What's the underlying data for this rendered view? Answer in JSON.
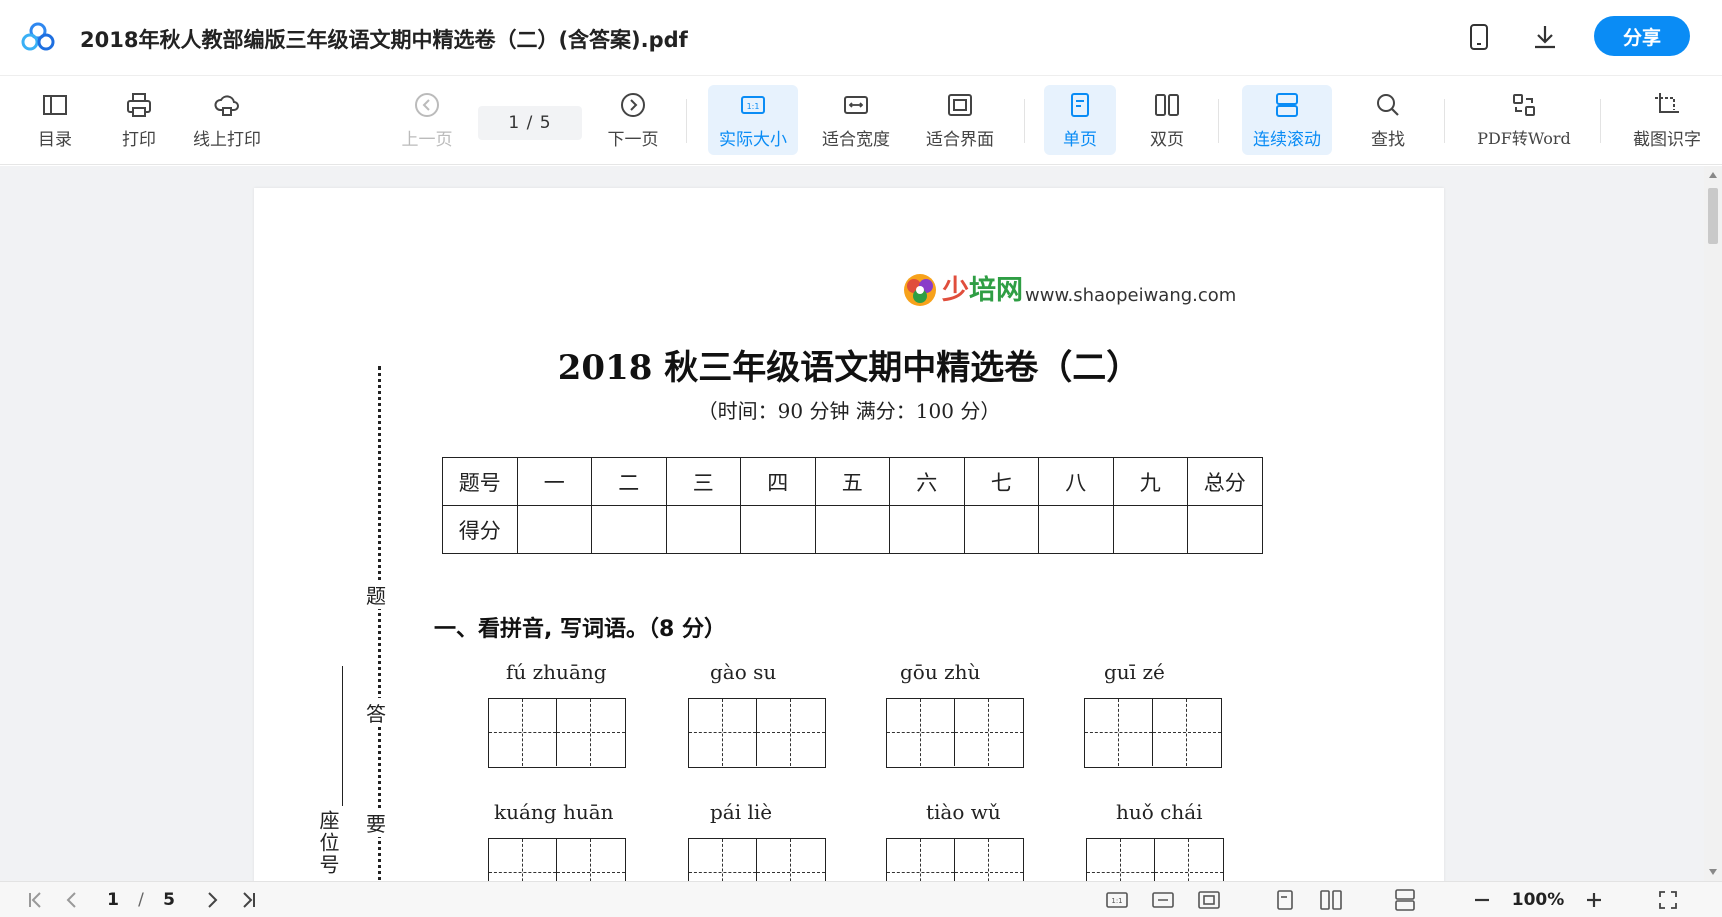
{
  "window": {
    "title": "2018年秋人教部编版三年级语文期中精选卷（二）(含答案).pdf",
    "share_label": "分享"
  },
  "toolbar": {
    "toc": "目录",
    "print": "打印",
    "online_print": "线上打印",
    "prev_page": "上一页",
    "page_indicator": "1 / 5",
    "next_page": "下一页",
    "actual_size": "实际大小",
    "fit_width": "适合宽度",
    "fit_screen": "适合界面",
    "single_page": "单页",
    "double_page": "双页",
    "continuous_scroll": "连续滚动",
    "find": "查找",
    "pdf_to_word": "PDF转Word",
    "ocr": "截图识字",
    "accent_color": "#0a8cf5"
  },
  "document": {
    "brand_cn_1": "少",
    "brand_cn_2": "培网",
    "brand_url": "www.shaopeiwang.com",
    "title": "2018 秋三年级语文期中精选卷（二）",
    "subtitle": "（时间：90 分钟    满分：100 分）",
    "score_table": {
      "row1": [
        "题号",
        "一",
        "二",
        "三",
        "四",
        "五",
        "六",
        "七",
        "八",
        "九",
        "总分"
      ],
      "row2": [
        "得分",
        "",
        "",
        "",
        "",
        "",
        "",
        "",
        "",
        "",
        ""
      ]
    },
    "side_chars": [
      "题",
      "答",
      "要"
    ],
    "seat_label": "座位号",
    "question1": "一、看拼音, 写词语。（8 分）",
    "pinyin_row1": [
      "fú   zhuāng",
      "gào     su",
      "gōu   zhù",
      "guī     zé"
    ],
    "pinyin_row2": [
      "kuáng  huān",
      "pái     liè",
      "tiào     wǔ",
      "huǒ     chái"
    ]
  },
  "statusbar": {
    "page_current": "1",
    "page_sep": "/",
    "page_total": "5",
    "zoom": "100%"
  }
}
